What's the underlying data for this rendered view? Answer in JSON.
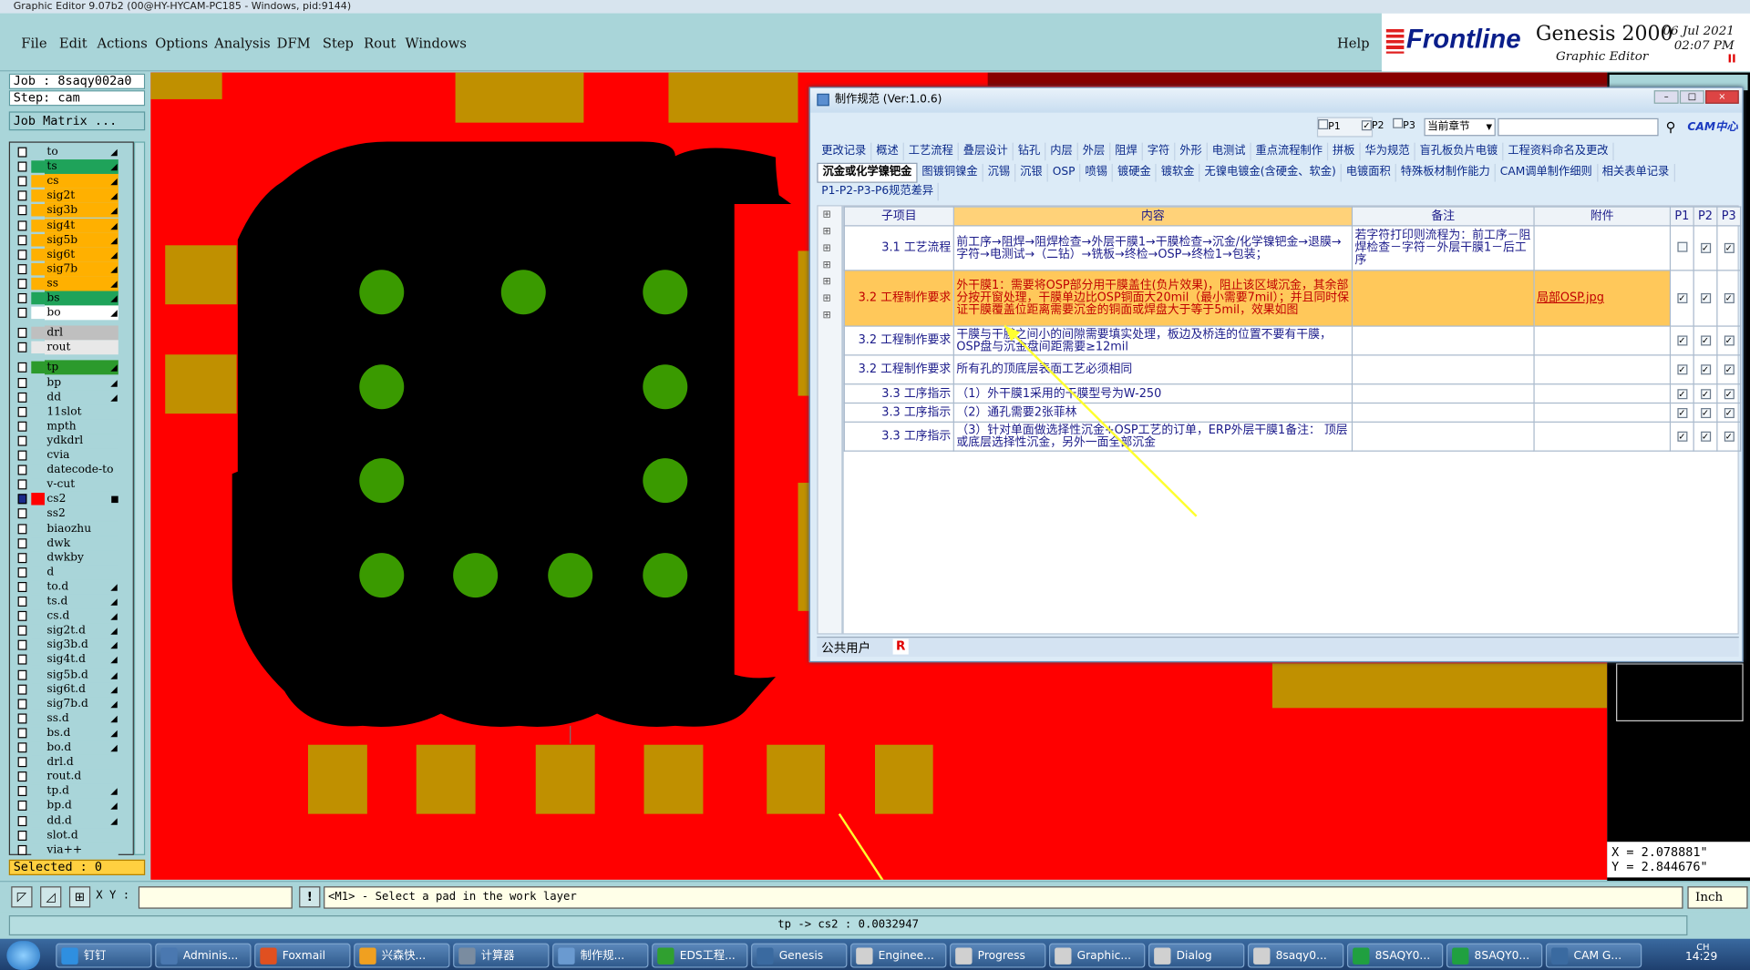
{
  "window_title": "Graphic Editor 9.07b2 (00@HY-HYCAM-PC185 - Windows, pid:9144)",
  "menu": {
    "file": "File",
    "edit": "Edit",
    "actions": "Actions",
    "options": "Options",
    "analysis": "Analysis",
    "dfm": "DFM",
    "step": "Step",
    "rout": "Rout",
    "windows": "Windows",
    "help": "Help"
  },
  "brand": {
    "logo": "Frontline",
    "product": "Genesis 2000",
    "subtitle": "Graphic Editor",
    "date": "06 Jul 2021",
    "time": "02:07 PM",
    "pause": "II"
  },
  "job": {
    "job": "Job : 8saqy002a0",
    "step": "Step: cam",
    "matrix": "Job Matrix ..."
  },
  "layers": [
    {
      "name": "to",
      "color": "#a9d5d9",
      "arrow": "◢"
    },
    {
      "name": "ts",
      "color": "#1fa35a",
      "arrow": "◢"
    },
    {
      "name": "cs",
      "color": "#ffb000",
      "arrow": "◢"
    },
    {
      "name": "sig2t",
      "color": "#ffb000",
      "arrow": "◢"
    },
    {
      "name": "sig3b",
      "color": "#ffb000",
      "arrow": "◢"
    },
    {
      "name": "sig4t",
      "color": "#ffb000",
      "arrow": "◢"
    },
    {
      "name": "sig5b",
      "color": "#ffb000",
      "arrow": "◢"
    },
    {
      "name": "sig6t",
      "color": "#ffb000",
      "arrow": "◢"
    },
    {
      "name": "sig7b",
      "color": "#ffb000",
      "arrow": "◢"
    },
    {
      "name": "ss",
      "color": "#ffb000",
      "arrow": "◢"
    },
    {
      "name": "bs",
      "color": "#1fa35a",
      "arrow": "◢"
    },
    {
      "name": "bo",
      "color": "#ffffff",
      "arrow": "◢"
    },
    {
      "name": "drl",
      "color": "#bfbfbf",
      "arrow": ""
    },
    {
      "name": "rout",
      "color": "#e8e8e8",
      "arrow": ""
    },
    {
      "name": "tp",
      "color": "#2c9a2c",
      "arrow": "◢"
    },
    {
      "name": "bp",
      "color": "#a9d5d9",
      "arrow": "◢"
    },
    {
      "name": "dd",
      "color": "#a9d5d9",
      "arrow": "◢"
    },
    {
      "name": "11slot",
      "color": "#a9d5d9",
      "arrow": ""
    },
    {
      "name": "mpth",
      "color": "#a9d5d9",
      "arrow": ""
    },
    {
      "name": "ydkdrl",
      "color": "#a9d5d9",
      "arrow": ""
    },
    {
      "name": "cvia",
      "color": "#a9d5d9",
      "arrow": ""
    },
    {
      "name": "datecode-to",
      "color": "#a9d5d9",
      "arrow": ""
    },
    {
      "name": "v-cut",
      "color": "#a9d5d9",
      "arrow": ""
    },
    {
      "name": "cs2",
      "color": "#ff0000",
      "arrow": "■"
    },
    {
      "name": "ss2",
      "color": "#a9d5d9",
      "arrow": ""
    },
    {
      "name": "biaozhu",
      "color": "#a9d5d9",
      "arrow": ""
    },
    {
      "name": "dwk",
      "color": "#a9d5d9",
      "arrow": ""
    },
    {
      "name": "dwkby",
      "color": "#a9d5d9",
      "arrow": ""
    },
    {
      "name": "d",
      "color": "#a9d5d9",
      "arrow": ""
    },
    {
      "name": "to.d",
      "color": "#a9d5d9",
      "arrow": "◢"
    },
    {
      "name": "ts.d",
      "color": "#a9d5d9",
      "arrow": "◢"
    },
    {
      "name": "cs.d",
      "color": "#a9d5d9",
      "arrow": "◢"
    },
    {
      "name": "sig2t.d",
      "color": "#a9d5d9",
      "arrow": "◢"
    },
    {
      "name": "sig3b.d",
      "color": "#a9d5d9",
      "arrow": "◢"
    },
    {
      "name": "sig4t.d",
      "color": "#a9d5d9",
      "arrow": "◢"
    },
    {
      "name": "sig5b.d",
      "color": "#a9d5d9",
      "arrow": "◢"
    },
    {
      "name": "sig6t.d",
      "color": "#a9d5d9",
      "arrow": "◢"
    },
    {
      "name": "sig7b.d",
      "color": "#a9d5d9",
      "arrow": "◢"
    },
    {
      "name": "ss.d",
      "color": "#a9d5d9",
      "arrow": "◢"
    },
    {
      "name": "bs.d",
      "color": "#a9d5d9",
      "arrow": "◢"
    },
    {
      "name": "bo.d",
      "color": "#a9d5d9",
      "arrow": "◢"
    },
    {
      "name": "drl.d",
      "color": "#a9d5d9",
      "arrow": ""
    },
    {
      "name": "rout.d",
      "color": "#a9d5d9",
      "arrow": ""
    },
    {
      "name": "tp.d",
      "color": "#a9d5d9",
      "arrow": "◢"
    },
    {
      "name": "bp.d",
      "color": "#a9d5d9",
      "arrow": "◢"
    },
    {
      "name": "dd.d",
      "color": "#a9d5d9",
      "arrow": "◢"
    },
    {
      "name": "slot.d",
      "color": "#a9d5d9",
      "arrow": ""
    },
    {
      "name": "via++",
      "color": "#a9d5d9",
      "arrow": ""
    }
  ],
  "selected": "Selected : 0",
  "coords": {
    "x": "X = 2.078881\"",
    "y": "Y = 2.844676\""
  },
  "command": {
    "xy_label": "X Y :",
    "xy_value": "",
    "prompt": "<M1> - Select a pad in the work layer",
    "units": "Inch"
  },
  "status": "tp -> cs2 : 0.0032947",
  "dialog": {
    "title": "制作规范 (Ver:1.0.6)",
    "p_filters": [
      "P1",
      "P2",
      "P3"
    ],
    "chapter_select": "当前章节",
    "search_value": "",
    "cam_logo": "CAM中心",
    "tabs_row1": [
      "更改记录",
      "概述",
      "工艺流程",
      "叠层设计",
      "钻孔",
      "内层",
      "外层",
      "阻焊",
      "字符",
      "外形",
      "电测试",
      "重点流程制作",
      "拼板",
      "华为规范",
      "盲孔板负片电镀",
      "工程资料命名及更改"
    ],
    "tabs_row2": [
      "沉金或化学镍钯金",
      "图镀铜镍金",
      "沉锡",
      "沉银",
      "OSP",
      "喷锡",
      "镀硬金",
      "镀软金",
      "无镍电镀金(含硬金、软金)",
      "电镀面积",
      "特殊板材制作能力",
      "CAM调单制作细则",
      "相关表单记录"
    ],
    "tabs_row3": [
      "P1-P2-P3-P6规范差异"
    ],
    "headers": {
      "item": "子项目",
      "content": "内容",
      "note": "备注",
      "attach": "附件",
      "p1": "P1",
      "p2": "P2",
      "p3": "P3"
    },
    "rows": [
      {
        "item": "3.1 工艺流程",
        "content": "前工序→阻焊→阻焊检查→外层干膜1→干膜检查→沉金/化学镍钯金→退膜→字符→电测试→（二钻）→铣板→终检→OSP→终检1→包装；",
        "note": "若字符打印则流程为：前工序－阻焊检查－字符－外层干膜1－后工序",
        "attach": "",
        "p1": false,
        "p2": true,
        "p3": true
      },
      {
        "item": "3.2 工程制作要求",
        "content": "外干膜1：需要将OSP部分用干膜盖住(负片效果)，阻止该区域沉金，其余部分按开窗处理，干膜单边比OSP铜面大20mil（最小需要7mil）；并且同时保证干膜覆盖位距离需要沉金的铜面或焊盘大于等于5mil，效果如图",
        "note": "",
        "attach": "局部OSP.jpg",
        "p1": true,
        "p2": true,
        "p3": true
      },
      {
        "item": "3.2 工程制作要求",
        "content": "干膜与干膜之间小的间隙需要填实处理，板边及桥连的位置不要有干膜，OSP盘与沉金盘间距需要≥12mil",
        "note": "",
        "attach": "",
        "p1": true,
        "p2": true,
        "p3": true
      },
      {
        "item": "3.2 工程制作要求",
        "content": "所有孔的顶底层表面工艺必须相同",
        "note": "",
        "attach": "",
        "p1": true,
        "p2": true,
        "p3": true
      },
      {
        "item": "3.3 工序指示",
        "content": "（1）外干膜1采用的干膜型号为W-250",
        "note": "",
        "attach": "",
        "p1": true,
        "p2": true,
        "p3": true
      },
      {
        "item": "3.3 工序指示",
        "content": "（2）通孔需要2张菲林",
        "note": "",
        "attach": "",
        "p1": true,
        "p2": true,
        "p3": true
      },
      {
        "item": "3.3 工序指示",
        "content": "（3）针对单面做选择性沉金+OSP工艺的订单，ERP外层干膜1备注： 顶层或底层选择性沉金，另外一面全部沉金",
        "note": "",
        "attach": "",
        "p1": true,
        "p2": true,
        "p3": true
      }
    ],
    "footer_user": "公共用户",
    "footer_r": "R"
  },
  "taskbar": [
    {
      "label": "钉钉",
      "color": "#2f8fe0"
    },
    {
      "label": "Adminis...",
      "color": "#4a78b0"
    },
    {
      "label": "Foxmail",
      "color": "#e05020"
    },
    {
      "label": "兴森快...",
      "color": "#f0a020"
    },
    {
      "label": "计算器",
      "color": "#7a8ca0"
    },
    {
      "label": "制作规...",
      "color": "#6a9ad0"
    },
    {
      "label": "EDS工程...",
      "color": "#30a030"
    },
    {
      "label": "Genesis",
      "color": "#3a6aa0"
    },
    {
      "label": "Enginee...",
      "color": "#d0d0d0"
    },
    {
      "label": "Progress",
      "color": "#d0d0d0"
    },
    {
      "label": "Graphic...",
      "color": "#d0d0d0"
    },
    {
      "label": "Dialog",
      "color": "#d0d0d0"
    },
    {
      "label": "8saqy0...",
      "color": "#d0d0d0"
    },
    {
      "label": "8SAQY0...",
      "color": "#20a040"
    },
    {
      "label": "8SAQY0...",
      "color": "#20a040"
    },
    {
      "label": "CAM G...",
      "color": "#3a6aa0"
    }
  ],
  "tray": {
    "lang": "CH",
    "time": "14:29"
  }
}
